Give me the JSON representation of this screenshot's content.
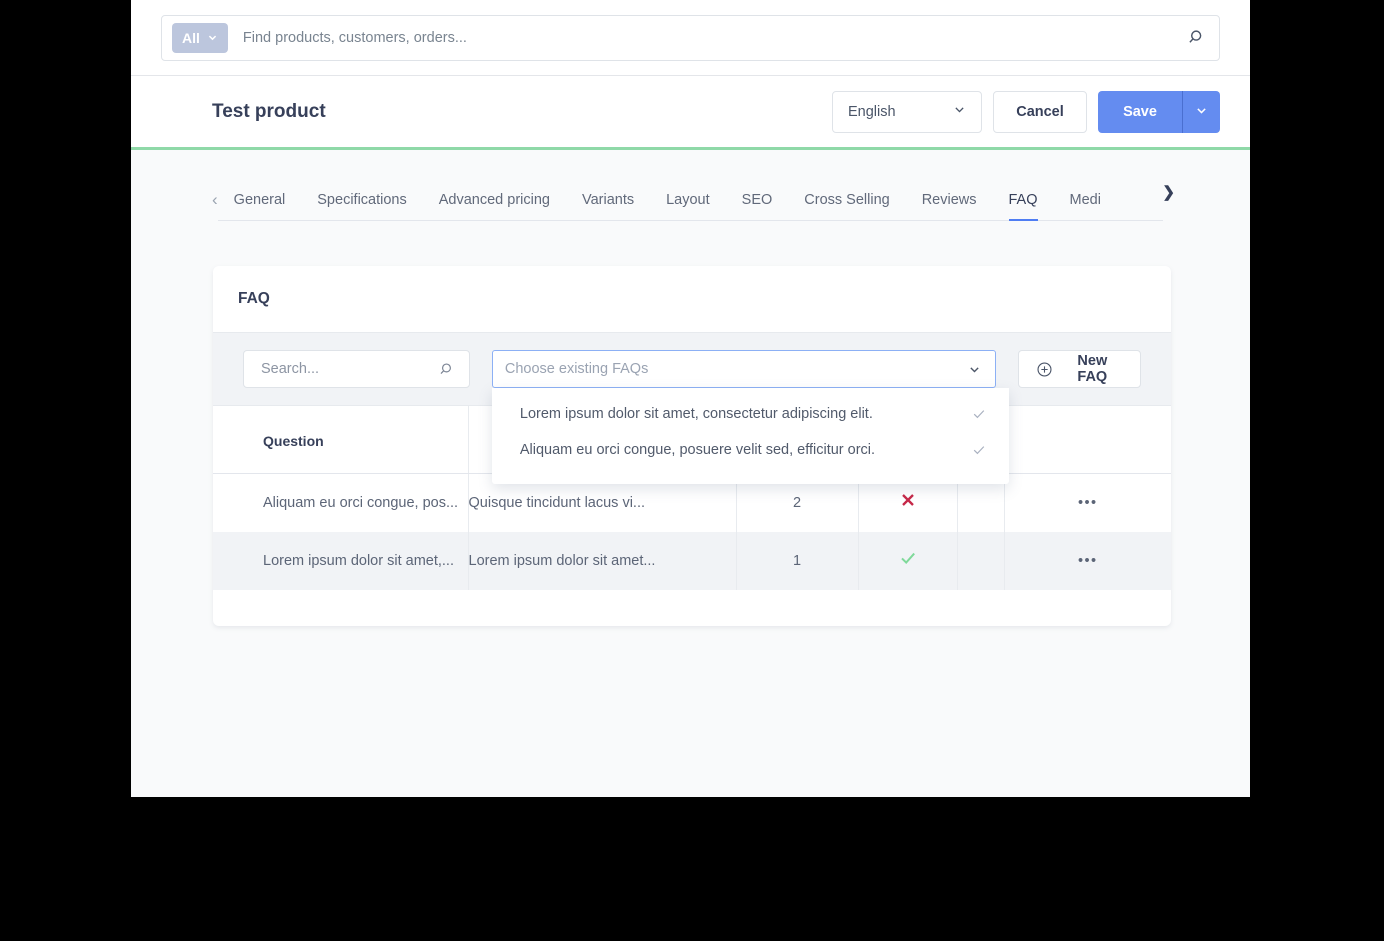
{
  "global_search": {
    "scope_label": "All",
    "scope_icon": "chevron-down-icon",
    "placeholder": "Find products, customers, orders...",
    "search_icon": "search-icon"
  },
  "header": {
    "title": "Test product",
    "language": "English",
    "language_caret": "chevron-down-icon",
    "cancel_label": "Cancel",
    "save_label": "Save",
    "save_caret": "chevron-down-icon",
    "accent_bar_color": "#8fd9a8"
  },
  "tabs": {
    "prev_arrow": "chevron-left-icon",
    "next_arrow": "chevron-right-icon",
    "items": [
      {
        "label": "General",
        "active": false
      },
      {
        "label": "Specifications",
        "active": false
      },
      {
        "label": "Advanced pricing",
        "active": false
      },
      {
        "label": "Variants",
        "active": false
      },
      {
        "label": "Layout",
        "active": false
      },
      {
        "label": "SEO",
        "active": false
      },
      {
        "label": "Cross Selling",
        "active": false
      },
      {
        "label": "Reviews",
        "active": false
      },
      {
        "label": "FAQ",
        "active": true
      },
      {
        "label": "Medi",
        "active": false
      }
    ],
    "active_underline_color": "#4f7df3"
  },
  "faq_card": {
    "title": "FAQ",
    "toolbar": {
      "search_placeholder": "Search...",
      "search_icon": "search-icon",
      "combo_placeholder": "Choose existing FAQs",
      "combo_caret": "chevron-down-icon",
      "combo_focused": true,
      "combo_options": [
        {
          "label": "Lorem ipsum dolor sit amet, consectetur adipiscing elit.",
          "check_icon": "check-icon"
        },
        {
          "label": "Aliquam eu orci congue, posuere velit sed, efficitur orci.",
          "check_icon": "check-icon"
        }
      ],
      "new_faq_label": "New FAQ",
      "new_faq_icon": "plus-circle-icon"
    },
    "table": {
      "columns": [
        "Question",
        "",
        "",
        "",
        "",
        ""
      ],
      "rows": [
        {
          "question": "Aliquam eu orci congue, pos...",
          "answer": "Quisque tincidunt lacus vi...",
          "number": "2",
          "flag": "cross-icon",
          "flag_color": "#c62848",
          "blank": "",
          "menu": "•••"
        },
        {
          "question": "Lorem ipsum dolor sit amet,...",
          "answer": "Lorem ipsum dolor sit amet...",
          "number": "1",
          "flag": "check-icon",
          "flag_color": "#7fd99a",
          "blank": "",
          "menu": "•••"
        }
      ]
    }
  }
}
